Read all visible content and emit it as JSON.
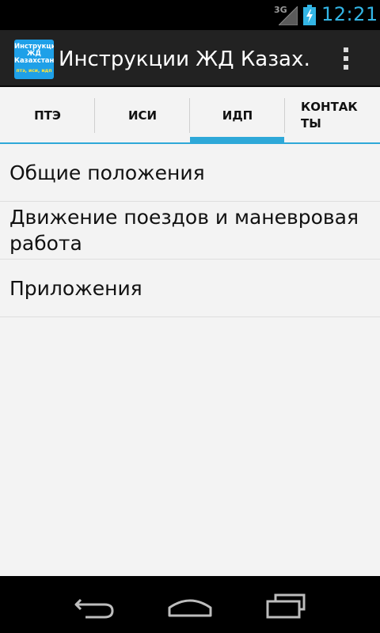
{
  "status_bar": {
    "network_type": "3G",
    "time": "12:21",
    "signal_icon": "signal-strength-icon",
    "battery_icon": "battery-charging-icon"
  },
  "action_bar": {
    "app_icon_lines": [
      "Инструкции",
      "ЖД",
      "Казахстана"
    ],
    "app_icon_subtitle": "птэ, иси, идп",
    "title": "Инструкции ЖД Казах…",
    "overflow_icon": "overflow-menu-icon"
  },
  "tabs": [
    {
      "label": "ПТЭ"
    },
    {
      "label": "ИСИ"
    },
    {
      "label": "ИДП"
    },
    {
      "label": "КОНТАКТЫ",
      "line1": "КОНТАК",
      "line2": "ТЫ"
    }
  ],
  "selected_tab": "ИДП",
  "list": {
    "items": [
      {
        "label": "Общие положения"
      },
      {
        "label": "Движение поездов и маневровая работа"
      },
      {
        "label": "Приложения"
      }
    ]
  },
  "nav_bar": {
    "back_icon": "back-icon",
    "home_icon": "home-icon",
    "recents_icon": "recent-apps-icon"
  },
  "colors": {
    "accent": "#33b5e5",
    "tab_indicator": "#2ea8d8",
    "action_bar": "#222222",
    "background": "#f3f3f3",
    "app_icon_bg": "#1ea0e8"
  }
}
